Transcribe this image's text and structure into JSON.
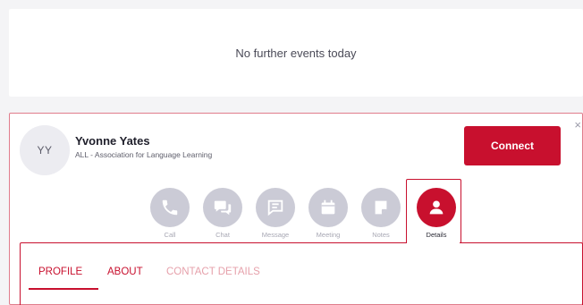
{
  "events": {
    "message": "No further events today"
  },
  "contact": {
    "initials": "YY",
    "name": "Yvonne Yates",
    "organization": "ALL - Association for Language Learning",
    "connect_label": "Connect",
    "close_label": "×"
  },
  "actions": [
    {
      "label": "Call",
      "icon": "phone-icon",
      "active": false
    },
    {
      "label": "Chat",
      "icon": "chat-bubbles-icon",
      "active": false
    },
    {
      "label": "Message",
      "icon": "message-icon",
      "active": false
    },
    {
      "label": "Meeting",
      "icon": "calendar-icon",
      "active": false
    },
    {
      "label": "Notes",
      "icon": "note-icon",
      "active": false
    },
    {
      "label": "Details",
      "icon": "person-icon",
      "active": true
    }
  ],
  "tabs": [
    {
      "label": "PROFILE",
      "active": true
    },
    {
      "label": "ABOUT",
      "active": false
    },
    {
      "label": "CONTACT DETAILS",
      "active": false
    }
  ],
  "colors": {
    "accent": "#c8102e",
    "inactive_icon_bg": "#cbcbd6",
    "page_bg": "#f4f4f6"
  }
}
